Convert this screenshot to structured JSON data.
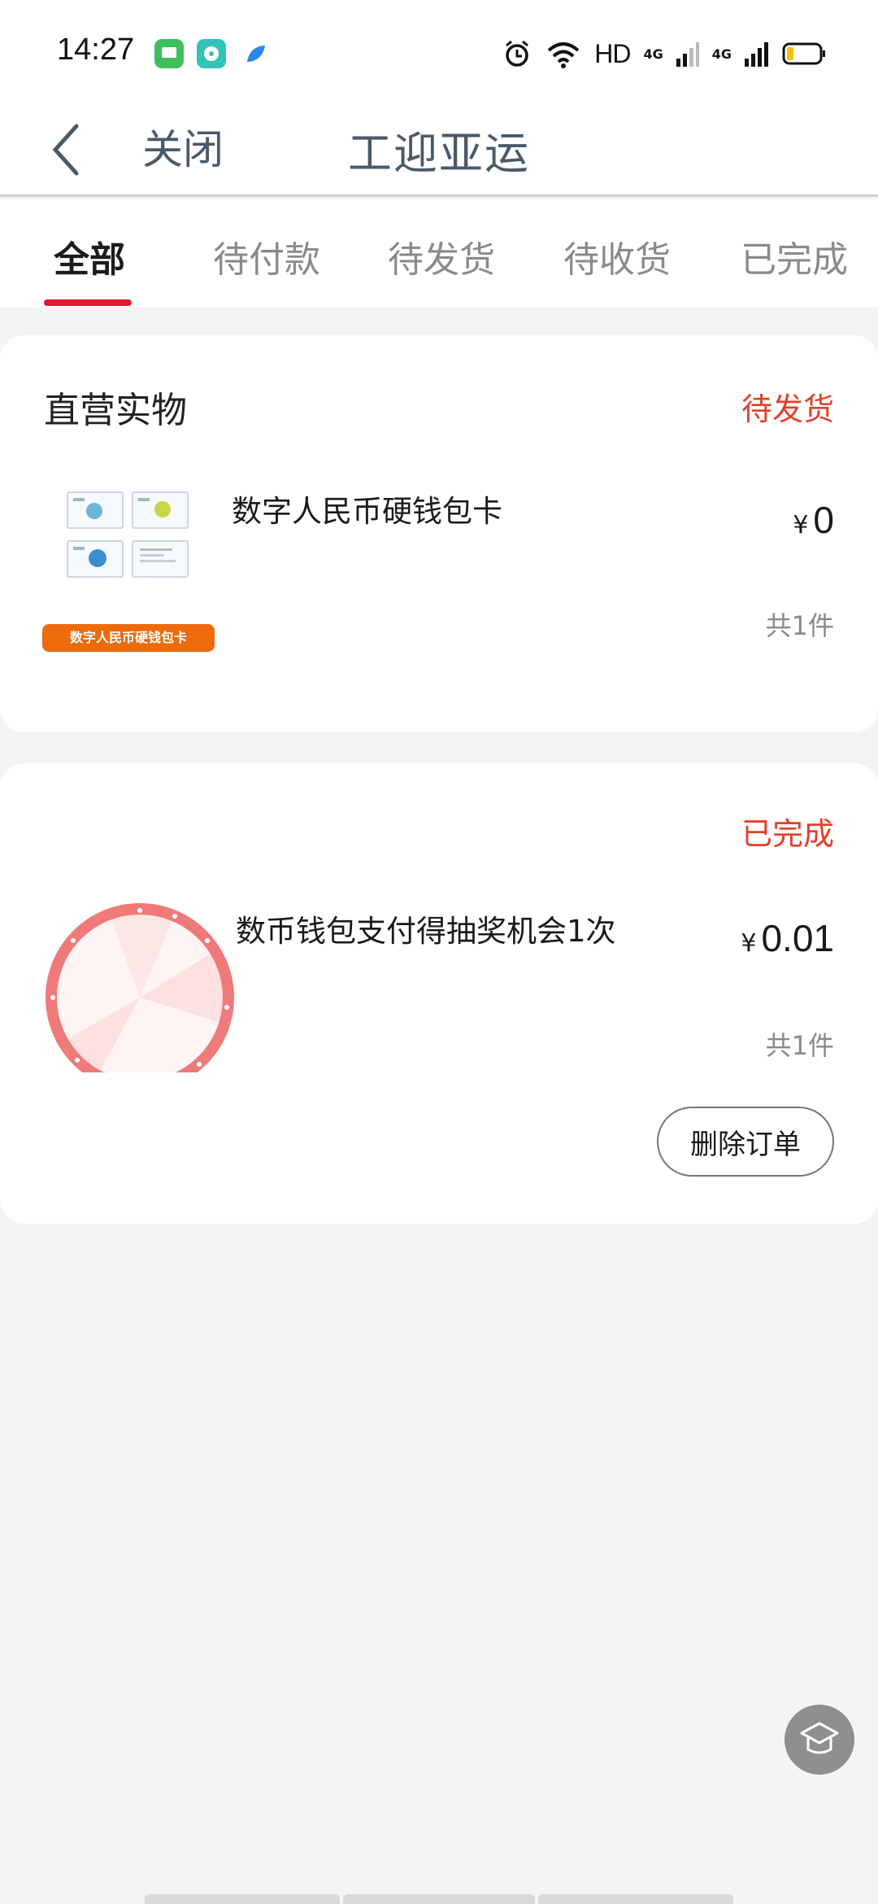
{
  "status_bar": {
    "time": "14:27",
    "hd": "HD",
    "net1": "4G",
    "net2": "4G"
  },
  "nav": {
    "close": "关闭",
    "title": "工迎亚运"
  },
  "tabs": [
    {
      "label": "全部",
      "active": true
    },
    {
      "label": "待付款",
      "active": false
    },
    {
      "label": "待发货",
      "active": false
    },
    {
      "label": "待收货",
      "active": false
    },
    {
      "label": "已完成",
      "active": false
    }
  ],
  "orders": [
    {
      "section": "直营实物",
      "status": "待发货",
      "product": "数字人民币硬钱包卡",
      "thumb_tag": "数字人民币硬钱包卡",
      "currency": "¥",
      "price": "0",
      "quantity": "共1件"
    },
    {
      "status": "已完成",
      "product": "数币钱包支付得抽奖机会1次",
      "currency": "¥",
      "price": "0.01",
      "quantity": "共1件",
      "action": "删除订单"
    }
  ],
  "colors": {
    "accent_red": "#e0192f",
    "status_red": "#e2402a",
    "orange": "#ec6b0c"
  }
}
